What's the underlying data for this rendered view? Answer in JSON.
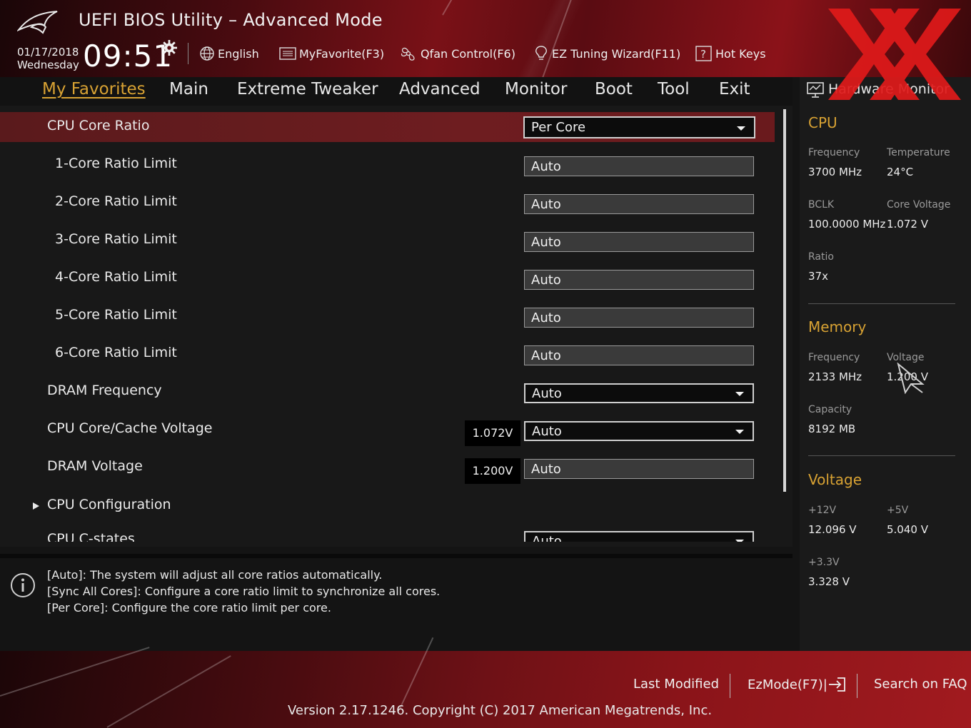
{
  "header": {
    "title": "UEFI BIOS Utility – Advanced Mode",
    "date": "01/17/2018",
    "weekday": "Wednesday",
    "time": "09:51",
    "toolbar": [
      {
        "label": "English",
        "icon": "globe-icon"
      },
      {
        "label": "MyFavorite(F3)",
        "icon": "favorites-list-icon"
      },
      {
        "label": "Qfan Control(F6)",
        "icon": "fan-icon"
      },
      {
        "label": "EZ Tuning Wizard(F11)",
        "icon": "lightbulb-icon"
      },
      {
        "label": "Hot Keys",
        "icon": "question-box-icon"
      }
    ]
  },
  "nav": {
    "tabs": [
      "My Favorites",
      "Main",
      "Extreme Tweaker",
      "Advanced",
      "Monitor",
      "Boot",
      "Tool",
      "Exit"
    ],
    "active": "My Favorites"
  },
  "settings": [
    {
      "label": "CPU Core Ratio",
      "value": "Per Core",
      "type": "dropdown",
      "selected": true
    },
    {
      "label": "1-Core Ratio Limit",
      "value": "Auto",
      "type": "field"
    },
    {
      "label": "2-Core Ratio Limit",
      "value": "Auto",
      "type": "field"
    },
    {
      "label": "3-Core Ratio Limit",
      "value": "Auto",
      "type": "field"
    },
    {
      "label": "4-Core Ratio Limit",
      "value": "Auto",
      "type": "field"
    },
    {
      "label": "5-Core Ratio Limit",
      "value": "Auto",
      "type": "field"
    },
    {
      "label": "6-Core Ratio Limit",
      "value": "Auto",
      "type": "field"
    },
    {
      "label": "DRAM Frequency",
      "value": "Auto",
      "type": "dropdown"
    },
    {
      "label": "CPU Core/Cache Voltage",
      "value": "Auto",
      "type": "dropdown",
      "readout": "1.072V"
    },
    {
      "label": "DRAM Voltage",
      "value": "Auto",
      "type": "field",
      "readout": "1.200V"
    },
    {
      "label": "CPU Configuration",
      "type": "submenu"
    },
    {
      "label": "CPU C-states",
      "value": "Auto",
      "type": "dropdown"
    }
  ],
  "help": {
    "lines": [
      "[Auto]: The system will adjust all core ratios automatically.",
      "[Sync All Cores]: Configure a core ratio limit to synchronize all cores.",
      "[Per Core]: Configure the core ratio limit per core."
    ]
  },
  "hardware_monitor": {
    "title": "Hardware Monitor",
    "cpu": {
      "heading": "CPU",
      "frequency_label": "Frequency",
      "frequency": "3700 MHz",
      "temperature_label": "Temperature",
      "temperature": "24°C",
      "bclk_label": "BCLK",
      "bclk": "100.0000 MHz",
      "core_voltage_label": "Core Voltage",
      "core_voltage": "1.072 V",
      "ratio_label": "Ratio",
      "ratio": "37x"
    },
    "memory": {
      "heading": "Memory",
      "frequency_label": "Frequency",
      "frequency": "2133 MHz",
      "voltage_label": "Voltage",
      "voltage": "1.200 V",
      "capacity_label": "Capacity",
      "capacity": "8192 MB"
    },
    "voltage": {
      "heading": "Voltage",
      "v12_label": "+12V",
      "v12": "12.096 V",
      "v5_label": "+5V",
      "v5": "5.040 V",
      "v33_label": "+3.3V",
      "v33": "3.328 V"
    }
  },
  "footer": {
    "last_modified": "Last Modified",
    "ezmode": "EzMode(F7)|",
    "search": "Search on FAQ",
    "version": "Version 2.17.1246. Copyright (C) 2017 American Megatrends, Inc."
  },
  "colors": {
    "accent": "#d8a233",
    "selected_row": "#6e1d20",
    "brand_red": "#8b1219",
    "watermark": "#e01a1a"
  }
}
